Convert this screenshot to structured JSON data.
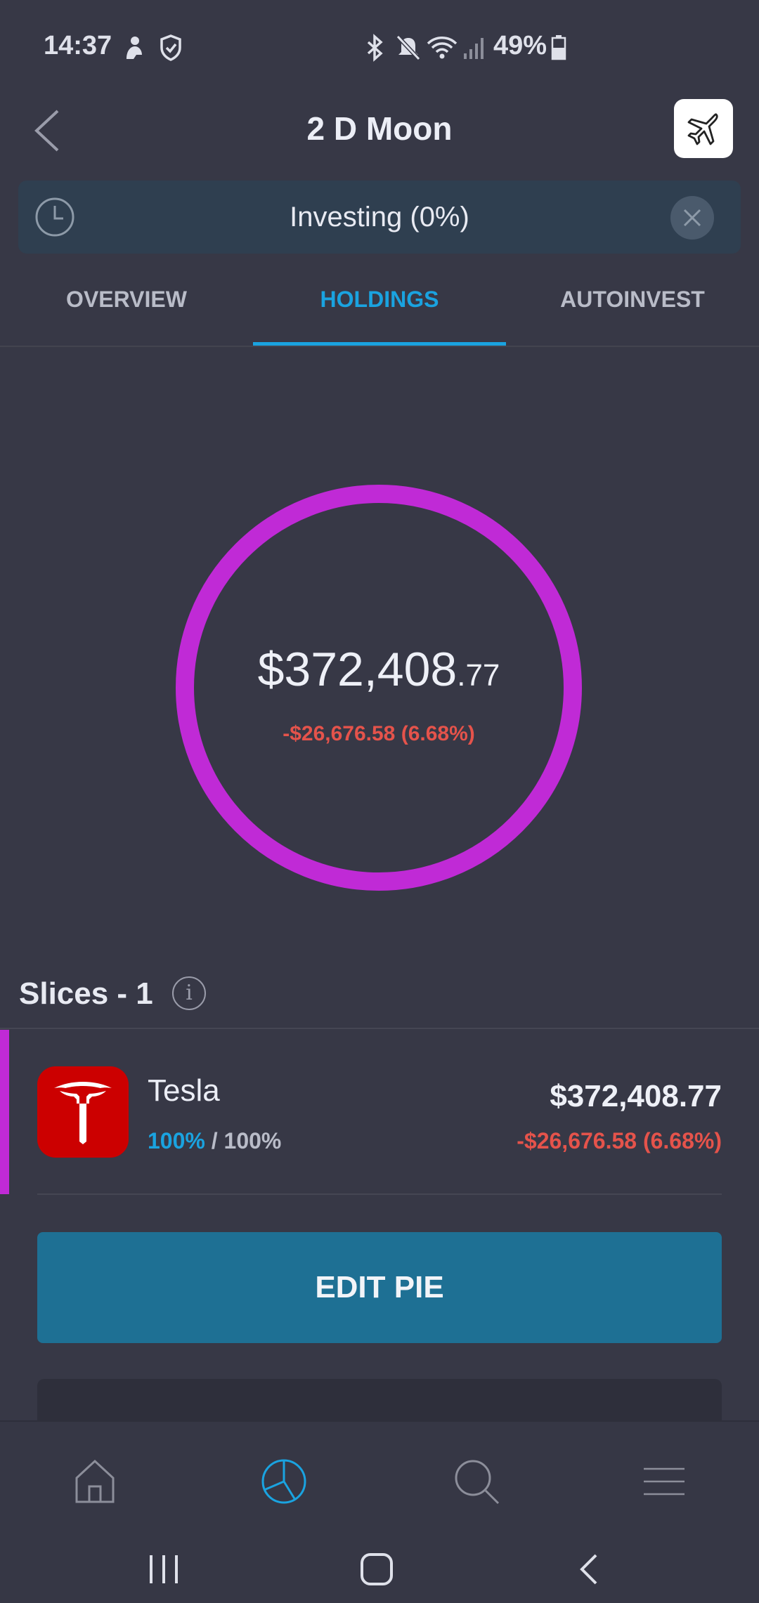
{
  "status_bar": {
    "time": "14:37",
    "battery": "49%",
    "icons": [
      "notification-person-icon",
      "shield-icon",
      "bluetooth-icon",
      "mute-icon",
      "wifi-icon",
      "signal-icon",
      "battery-icon"
    ]
  },
  "header": {
    "title": "2 D Moon"
  },
  "banner": {
    "text": "Investing (0%)"
  },
  "tabs": [
    {
      "label": "OVERVIEW",
      "active": false
    },
    {
      "label": "HOLDINGS",
      "active": true
    },
    {
      "label": "AUTOINVEST",
      "active": false
    }
  ],
  "summary": {
    "value_main": "$372,408",
    "value_cents": ".77",
    "change": "-$26,676.58 (6.68%)"
  },
  "slices": {
    "title": "Slices - 1",
    "items": [
      {
        "name": "Tesla",
        "current_pct": "100%",
        "separator": " / ",
        "target_pct": "100%",
        "value": "$372,408.77",
        "change": "-$26,676.58 (6.68%)",
        "color": "#c02ad6"
      }
    ]
  },
  "actions": {
    "edit_pie": "EDIT PIE"
  },
  "colors": {
    "accent": "#1aa3e0",
    "negative": "#e5534b",
    "slice": "#c02ad6",
    "button": "#1e7094",
    "background": "#373846"
  }
}
